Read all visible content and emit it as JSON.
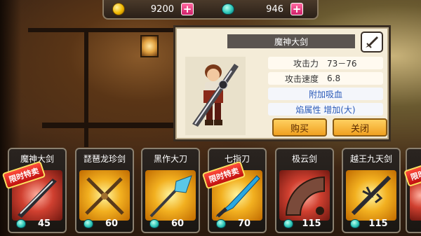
{
  "currency": {
    "gold": "9200",
    "gems": "946",
    "gold_icon": "gold-coin-icon",
    "gem_icon": "gem-icon",
    "add_icon": "plus-icon"
  },
  "detail": {
    "name": "魔神大剑",
    "type_icon": "sword-icon",
    "attack_label": "攻击力",
    "attack_value": "73－76",
    "speed_label": "攻击速度",
    "speed_value": "6.8",
    "effect1": "附加吸血",
    "effect2": "焰属性 增加(大)",
    "buy_label": "购买",
    "close_label": "关闭"
  },
  "cards": [
    {
      "name": "魔神大剑",
      "price": "45",
      "sale": "限时特卖",
      "art": "red"
    },
    {
      "name": "琵琶龙珍剑",
      "price": "60",
      "sale": "",
      "art": "gold"
    },
    {
      "name": "黑作大刀",
      "price": "60",
      "sale": "",
      "art": "gold"
    },
    {
      "name": "七指刀",
      "price": "70",
      "sale": "限时特卖",
      "art": "gold"
    },
    {
      "name": "极云剑",
      "price": "115",
      "sale": "",
      "art": "red"
    },
    {
      "name": "越王九天剑",
      "price": "115",
      "sale": "",
      "art": "gold"
    },
    {
      "name": "",
      "price": "",
      "sale": "限时",
      "art": "red"
    }
  ],
  "colors": {
    "panel_bg": "#f4ecd8",
    "button_gold": "#f0a020",
    "effect_blue": "#2a5ab8",
    "plus_pink": "#d0206a"
  }
}
